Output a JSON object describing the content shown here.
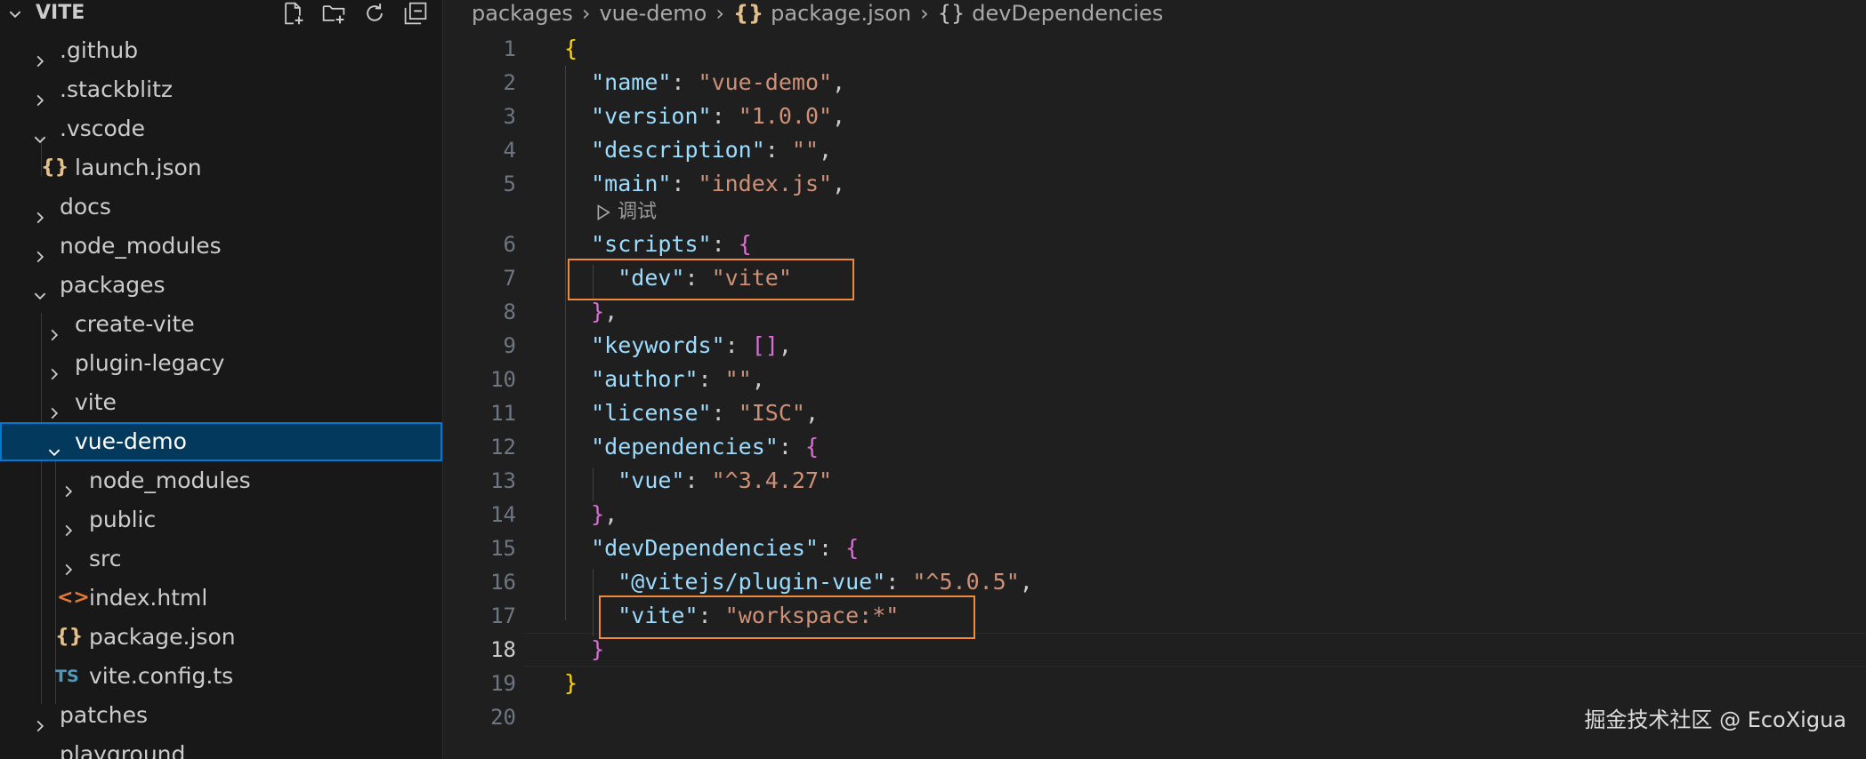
{
  "sidebar": {
    "title": "VITE",
    "actions": [
      "new-file-icon",
      "new-folder-icon",
      "refresh-icon",
      "collapse-all-icon"
    ],
    "items": [
      {
        "label": ".github",
        "type": "folder",
        "expanded": false,
        "depth": 0
      },
      {
        "label": ".stackblitz",
        "type": "folder",
        "expanded": false,
        "depth": 0
      },
      {
        "label": ".vscode",
        "type": "folder",
        "expanded": true,
        "depth": 0
      },
      {
        "label": "launch.json",
        "type": "json",
        "icon": "{}",
        "depth": 1
      },
      {
        "label": "docs",
        "type": "folder",
        "expanded": false,
        "depth": 0
      },
      {
        "label": "node_modules",
        "type": "folder",
        "expanded": false,
        "depth": 0
      },
      {
        "label": "packages",
        "type": "folder",
        "expanded": true,
        "depth": 0
      },
      {
        "label": "create-vite",
        "type": "folder",
        "expanded": false,
        "depth": 1
      },
      {
        "label": "plugin-legacy",
        "type": "folder",
        "expanded": false,
        "depth": 1
      },
      {
        "label": "vite",
        "type": "folder",
        "expanded": false,
        "depth": 1
      },
      {
        "label": "vue-demo",
        "type": "folder",
        "expanded": true,
        "depth": 1,
        "selected": true
      },
      {
        "label": "node_modules",
        "type": "folder",
        "expanded": false,
        "depth": 2
      },
      {
        "label": "public",
        "type": "folder",
        "expanded": false,
        "depth": 2
      },
      {
        "label": "src",
        "type": "folder",
        "expanded": false,
        "depth": 2
      },
      {
        "label": "index.html",
        "type": "html",
        "icon": "<>",
        "depth": 2
      },
      {
        "label": "package.json",
        "type": "json",
        "icon": "{}",
        "depth": 2
      },
      {
        "label": "vite.config.ts",
        "type": "ts",
        "icon": "TS",
        "depth": 2
      },
      {
        "label": "patches",
        "type": "folder",
        "expanded": false,
        "depth": 0
      },
      {
        "label": "playground",
        "type": "folder",
        "expanded": false,
        "depth": 0
      }
    ]
  },
  "breadcrumb": {
    "parts": [
      "packages",
      "vue-demo",
      "package.json",
      "devDependencies"
    ],
    "json_icon": "{}",
    "obj_icon": "{}"
  },
  "editor": {
    "codelens": "调试",
    "active_line": 18,
    "lines": [
      {
        "n": "1",
        "text": "{"
      },
      {
        "n": "2",
        "text": "  \"name\": \"vue-demo\","
      },
      {
        "n": "3",
        "text": "  \"version\": \"1.0.0\","
      },
      {
        "n": "4",
        "text": "  \"description\": \"\","
      },
      {
        "n": "5",
        "text": "  \"main\": \"index.js\","
      },
      {
        "n": "6",
        "text": "  \"scripts\": {"
      },
      {
        "n": "7",
        "text": "    \"dev\": \"vite\""
      },
      {
        "n": "8",
        "text": "  },"
      },
      {
        "n": "9",
        "text": "  \"keywords\": [],"
      },
      {
        "n": "10",
        "text": "  \"author\": \"\","
      },
      {
        "n": "11",
        "text": "  \"license\": \"ISC\","
      },
      {
        "n": "12",
        "text": "  \"dependencies\": {"
      },
      {
        "n": "13",
        "text": "    \"vue\": \"^3.4.27\""
      },
      {
        "n": "14",
        "text": "  },"
      },
      {
        "n": "15",
        "text": "  \"devDependencies\": {"
      },
      {
        "n": "16",
        "text": "    \"@vitejs/plugin-vue\": \"^5.0.5\","
      },
      {
        "n": "17",
        "text": "    \"vite\": \"workspace:*\""
      },
      {
        "n": "18",
        "text": "  }"
      },
      {
        "n": "19",
        "text": "}"
      },
      {
        "n": "20",
        "text": ""
      }
    ]
  },
  "watermark": "掘金技术社区 @ EcoXigua",
  "colors": {
    "key": "#9cdcfe",
    "string": "#ce9178",
    "brace_outer": "#ffd700",
    "brace_inner": "#da70d6",
    "highlight_box": "#f0883e",
    "selection": "#04395e"
  }
}
